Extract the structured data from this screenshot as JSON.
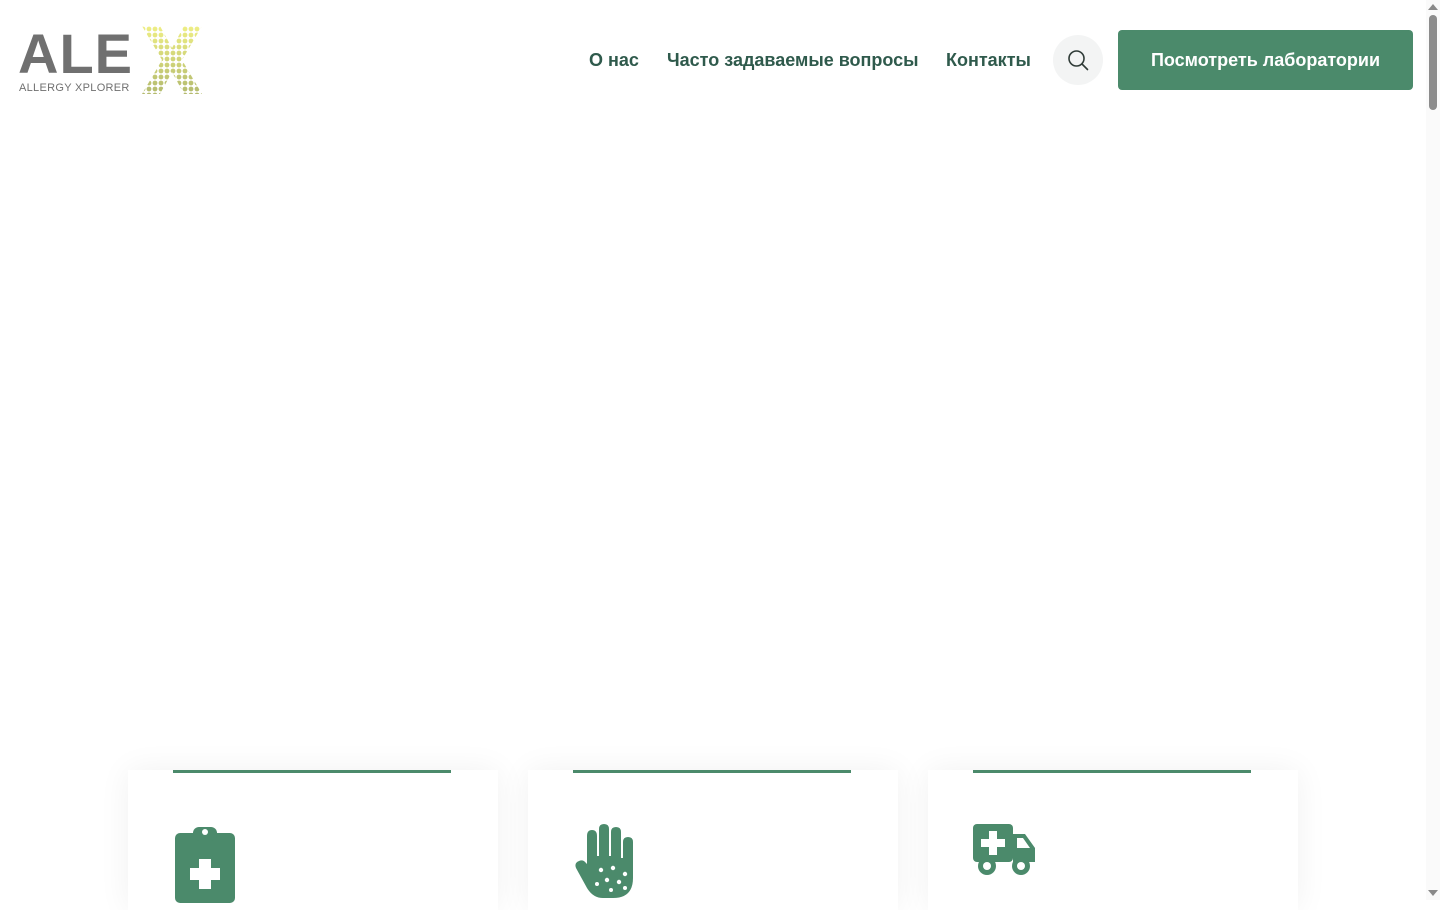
{
  "brand": {
    "logo_word": "ALE",
    "logo_tagline": "ALLERGY XPLORER",
    "logo_x_color": "#c7c33a",
    "logo_gray": "#707070"
  },
  "nav": {
    "items": [
      {
        "label": "О нас"
      },
      {
        "label": "Часто задаваемые вопросы"
      },
      {
        "label": "Контакты"
      }
    ],
    "search_icon": "search-icon",
    "cta_label": "Посмотреть лаборатории"
  },
  "colors": {
    "accent": "#4b8a6b",
    "nav_text": "#2f5a4c",
    "background": "#ffffff"
  },
  "cards": [
    {
      "icon": "clipboard-medical-icon"
    },
    {
      "icon": "hand-allergy-icon"
    },
    {
      "icon": "ambulance-icon"
    }
  ]
}
